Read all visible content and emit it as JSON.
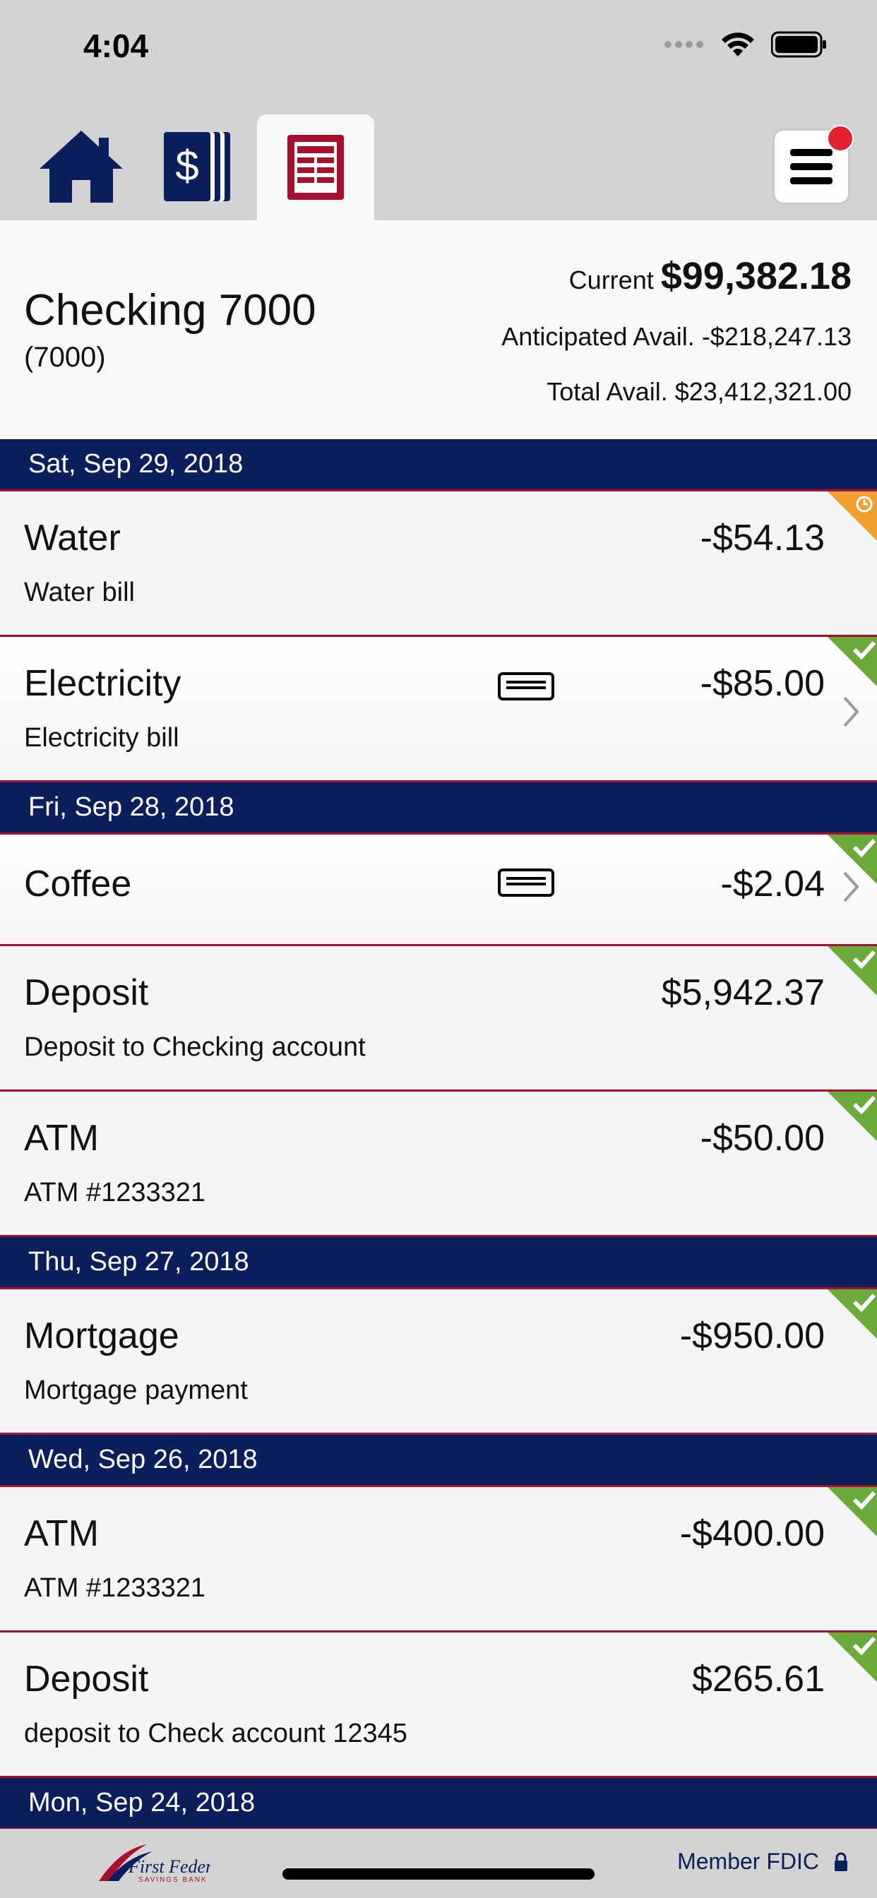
{
  "status_bar": {
    "time": "4:04"
  },
  "tabs": [
    {
      "name": "home",
      "icon": "home-icon"
    },
    {
      "name": "accounts",
      "icon": "dollar-cards-icon"
    },
    {
      "name": "transactions",
      "icon": "ledger-icon",
      "active": true
    }
  ],
  "menu": {
    "icon": "hamburger-menu-icon",
    "has_notification": true
  },
  "account": {
    "name": "Checking 7000",
    "number": "(7000)",
    "current_label": "Current",
    "current_value": "$99,382.18",
    "anticipated_label": "Anticipated Avail.",
    "anticipated_value": "-$218,247.13",
    "total_label": "Total Avail.",
    "total_value": "$23,412,321.00"
  },
  "groups": [
    {
      "date": "Sat, Sep 29, 2018",
      "transactions": [
        {
          "name": "Water",
          "desc": "Water bill",
          "amount": "-$54.13",
          "status": "pending"
        },
        {
          "name": "Electricity",
          "desc": "Electricity bill",
          "amount": "-$85.00",
          "status": "cleared",
          "card": true,
          "chevron": true
        }
      ]
    },
    {
      "date": "Fri, Sep 28, 2018",
      "transactions": [
        {
          "name": "Coffee",
          "desc": "",
          "amount": "-$2.04",
          "status": "cleared",
          "card": true,
          "chevron": true
        },
        {
          "name": "Deposit",
          "desc": "Deposit to Checking account",
          "amount": "$5,942.37",
          "status": "cleared"
        },
        {
          "name": "ATM",
          "desc": "ATM #1233321",
          "amount": "-$50.00",
          "status": "cleared"
        }
      ]
    },
    {
      "date": "Thu, Sep 27, 2018",
      "transactions": [
        {
          "name": "Mortgage",
          "desc": "Mortgage payment",
          "amount": "-$950.00",
          "status": "cleared"
        }
      ]
    },
    {
      "date": "Wed, Sep 26, 2018",
      "transactions": [
        {
          "name": "ATM",
          "desc": "ATM #1233321",
          "amount": "-$400.00",
          "status": "cleared"
        },
        {
          "name": "Deposit",
          "desc": "deposit to Check account 12345",
          "amount": "$265.61",
          "status": "cleared"
        }
      ]
    },
    {
      "date": "Mon, Sep 24, 2018",
      "transactions": []
    }
  ],
  "footer": {
    "logo_text": "First Federal",
    "logo_subtext": "SAVINGS BANK",
    "fdic_label": "Member FDIC"
  },
  "colors": {
    "navy": "#0b1f5c",
    "crimson": "#a8102e",
    "cleared_green": "#6aaa3a",
    "pending_orange": "#f0a030",
    "notification_red": "#e32231"
  }
}
